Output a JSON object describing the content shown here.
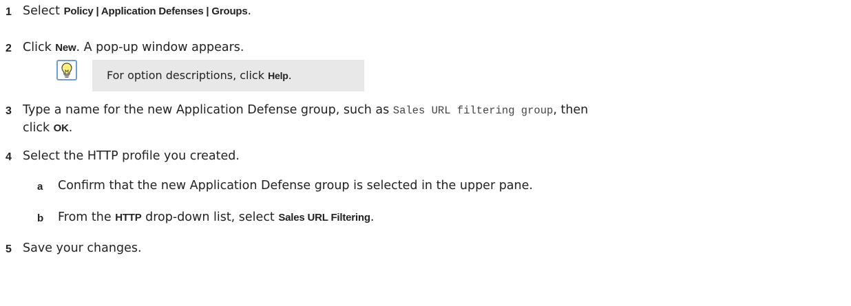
{
  "steps": [
    {
      "num": "1",
      "a": "Select ",
      "b": "Policy | Application Defenses | Groups",
      "c": "."
    },
    {
      "num": "2",
      "a": "Click ",
      "b": "New",
      "c": ". A pop-up window appears."
    },
    {
      "num": "3",
      "a": "Type a name for the new Application Defense group, such as ",
      "code": "Sales URL filtering group",
      "c": ", then",
      "line2a": "click ",
      "line2b": "OK",
      "line2c": "."
    },
    {
      "num": "4",
      "a": "Select the HTTP profile you created."
    },
    {
      "num": "5",
      "a": "Save your changes."
    }
  ],
  "substeps": [
    {
      "letter": "a",
      "a": "Confirm that the new Application Defense group is selected in the upper pane."
    },
    {
      "letter": "b",
      "a": "From the ",
      "b": "HTTP",
      "c": " drop-down list, select ",
      "d": "Sales URL Filtering",
      "e": "."
    }
  ],
  "tip": {
    "icon": "lightbulb-icon",
    "a": "For option descriptions, click ",
    "b": "Help",
    "c": "."
  }
}
